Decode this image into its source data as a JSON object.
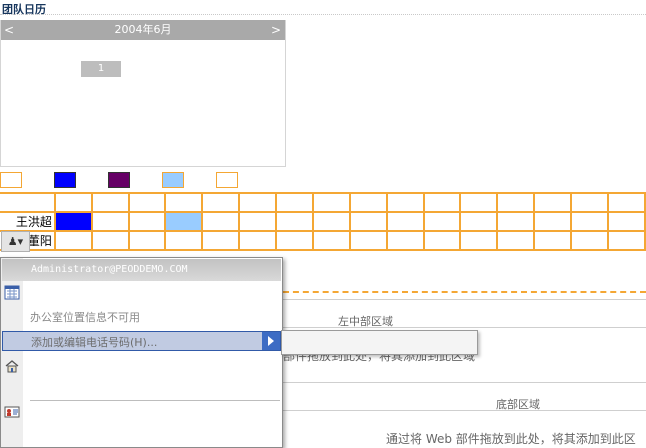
{
  "page_title": "团队日历",
  "calendar": {
    "month_label": "2004年6月",
    "prev": "<",
    "next": ">",
    "selected_day": "1"
  },
  "legend_colors": [
    "#ffffff",
    "#0000ff",
    "#660066",
    "#99ccff",
    "#ffffff"
  ],
  "grid": {
    "rows": [
      {
        "name": "",
        "cells": [
          "",
          "",
          "",
          "",
          "",
          "",
          "",
          "",
          "",
          "",
          "",
          "",
          "",
          "",
          "",
          ""
        ]
      },
      {
        "name": "王洪超",
        "cells": [
          "#0000ff",
          "",
          "",
          "#99ccff",
          "",
          "",
          "",
          "",
          "",
          "",
          "",
          "",
          "",
          "",
          "",
          ""
        ]
      },
      {
        "name": "董阳",
        "cells": [
          "",
          "",
          "",
          "",
          "",
          "",
          "",
          "",
          "",
          "",
          "",
          "",
          "",
          "",
          "",
          ""
        ]
      }
    ]
  },
  "zones": {
    "middle_left": "左中部区域",
    "bottom": "底部区域",
    "hint_partial": "通过将 Web 部件拖放到此处，将其添加到此区",
    "hint_obscured": "部件拖放到此处，将其添加到此区域"
  },
  "context_menu": {
    "email": "Administrator@PEODDEMO.COM",
    "office_info": "办公室位置信息不可用",
    "add_phone": "添加或编辑电话号码(H)...",
    "icons": [
      "calendar-icon",
      "house-icon",
      "contact-card-icon"
    ]
  }
}
